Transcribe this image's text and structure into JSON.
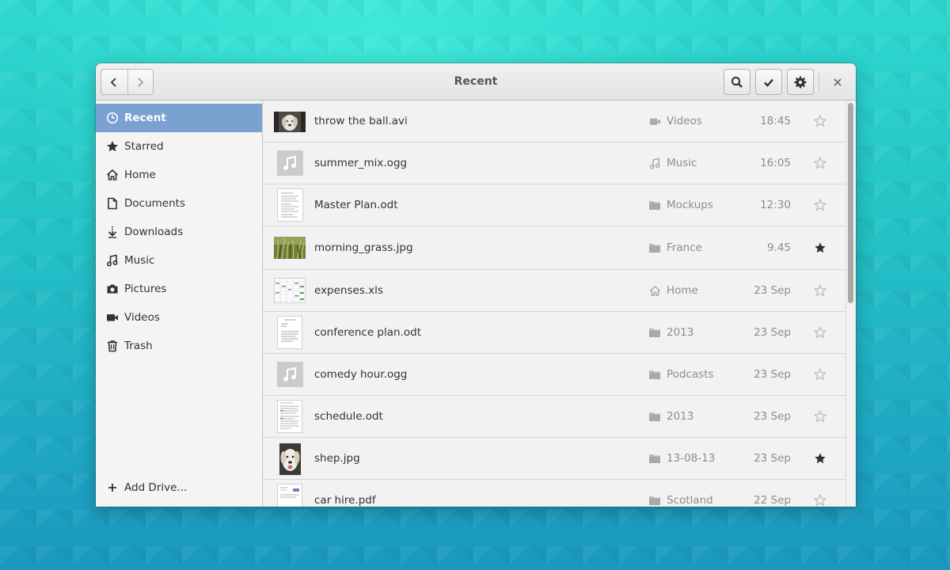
{
  "window": {
    "title": "Recent",
    "close_glyph": "×"
  },
  "header": {
    "back_icon": "chevron-left-icon",
    "forward_icon": "chevron-right-icon",
    "search_icon": "search-icon",
    "select_icon": "checkmark-icon",
    "settings_icon": "gear-icon"
  },
  "sidebar": {
    "items": [
      {
        "label": "Recent",
        "icon": "clock-icon",
        "active": true
      },
      {
        "label": "Starred",
        "icon": "star-icon"
      },
      {
        "label": "Home",
        "icon": "home-icon"
      },
      {
        "label": "Documents",
        "icon": "document-icon"
      },
      {
        "label": "Downloads",
        "icon": "download-icon"
      },
      {
        "label": "Music",
        "icon": "music-icon"
      },
      {
        "label": "Pictures",
        "icon": "camera-icon"
      },
      {
        "label": "Videos",
        "icon": "video-icon"
      },
      {
        "label": "Trash",
        "icon": "trash-icon"
      }
    ],
    "add_drive": {
      "label": "Add Drive...",
      "icon": "plus-icon"
    }
  },
  "files": [
    {
      "name": "throw the ball.avi",
      "thumb": "video-thumbnail",
      "location": "Videos",
      "location_icon": "video-icon",
      "time": "18:45",
      "starred": false
    },
    {
      "name": "summer_mix.ogg",
      "thumb": "music-placeholder",
      "location": "Music",
      "location_icon": "music-icon",
      "time": "16:05",
      "starred": false
    },
    {
      "name": "Master Plan.odt",
      "thumb": "document-thumbnail",
      "location": "Mockups",
      "location_icon": "folder-icon",
      "time": "12:30",
      "starred": false
    },
    {
      "name": "morning_grass.jpg",
      "thumb": "photo-thumbnail",
      "location": "France",
      "location_icon": "folder-icon",
      "time": "9.45",
      "starred": true
    },
    {
      "name": "expenses.xls",
      "thumb": "spreadsheet-thumbnail",
      "location": "Home",
      "location_icon": "home-icon",
      "time": "23 Sep",
      "starred": false
    },
    {
      "name": "conference plan.odt",
      "thumb": "document-thumbnail",
      "location": "2013",
      "location_icon": "folder-icon",
      "time": "23 Sep",
      "starred": false
    },
    {
      "name": "comedy hour.ogg",
      "thumb": "music-placeholder",
      "location": "Podcasts",
      "location_icon": "folder-icon",
      "time": "23 Sep",
      "starred": false
    },
    {
      "name": "schedule.odt",
      "thumb": "document-thumbnail",
      "location": "2013",
      "location_icon": "folder-icon",
      "time": "23 Sep",
      "starred": false
    },
    {
      "name": "shep.jpg",
      "thumb": "photo-thumbnail",
      "location": "13-08-13",
      "location_icon": "folder-icon",
      "time": "23 Sep",
      "starred": true
    },
    {
      "name": "car hire.pdf",
      "thumb": "document-thumbnail",
      "location": "Scotland",
      "location_icon": "folder-icon",
      "time": "22 Sep",
      "starred": false
    }
  ],
  "colors": {
    "accent": "#7ba1d1",
    "text": "#2e3436",
    "muted": "#8d8d8d"
  }
}
